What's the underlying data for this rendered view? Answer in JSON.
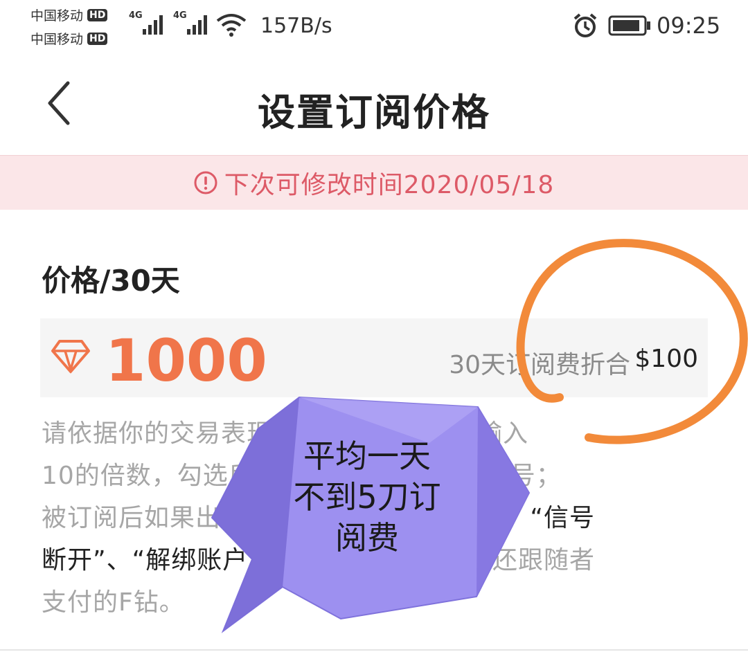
{
  "status_bar": {
    "carrier_1": "中国移动",
    "carrier_2": "中国移动",
    "hd_badge": "HD",
    "network_type": "4G",
    "net_speed": "157B/s",
    "time": "09:25"
  },
  "nav": {
    "title": "设置订阅价格"
  },
  "notice": {
    "text": "下次可修改时间2020/05/18"
  },
  "price": {
    "section_title": "价格/30天",
    "value": "1000",
    "conversion_label": "30天订阅费折合",
    "usd_value": "$100"
  },
  "description": {
    "line1": "请依据你的交易表现设置合理范围，可输入",
    "line2": "10的倍数，勾选后跟随者即可订阅你的信号；",
    "line3_pre": "被订阅后如果出现",
    "line3_dark": "“跟随者无法产生订单”、“信号",
    "line4_dark": "断开”、“解绑账户”",
    "line4_post": "等情况，审核后将退还跟随者",
    "line5": "支付的F钻。"
  },
  "annotation": {
    "bubble_text_1": "平均一天",
    "bubble_text_2": "不到5刀订",
    "bubble_text_3": "阅费",
    "circle_color": "#f28a3a",
    "bubble_color": "#8c7de6"
  },
  "colors": {
    "accent_price": "#f0754a",
    "notice_bg": "#fbe6e8",
    "notice_text": "#dd5a67"
  }
}
